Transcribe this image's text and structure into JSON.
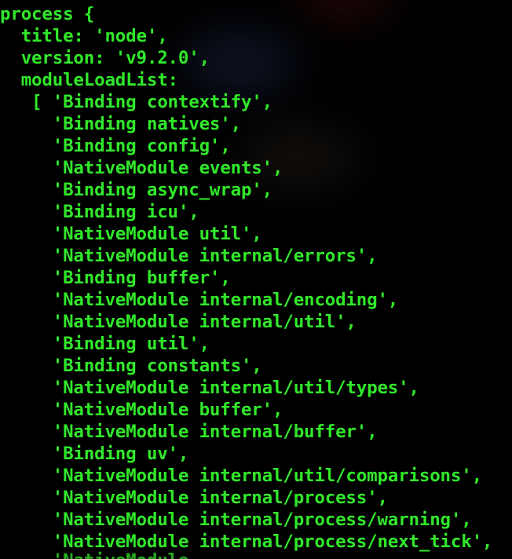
{
  "theme": {
    "text_color": "#31e82a",
    "background": "#000000"
  },
  "terminal": {
    "top_partial": "                   ",
    "lines": [
      "process {",
      "  title: 'node',",
      "  version: 'v9.2.0',",
      "  moduleLoadList:",
      "   [ 'Binding contextify',",
      "     'Binding natives',",
      "     'Binding config',",
      "     'NativeModule events',",
      "     'Binding async_wrap',",
      "     'Binding icu',",
      "     'NativeModule util',",
      "     'NativeModule internal/errors',",
      "     'Binding buffer',",
      "     'NativeModule internal/encoding',",
      "     'NativeModule internal/util',",
      "     'Binding util',",
      "     'Binding constants',",
      "     'NativeModule internal/util/types',",
      "     'NativeModule buffer',",
      "     'NativeModule internal/buffer',",
      "     'Binding uv',",
      "     'NativeModule internal/util/comparisons',",
      "     'NativeModule internal/process',",
      "     'NativeModule internal/process/warning',",
      "     'NativeModule internal/process/next_tick',"
    ],
    "bottom_partial": "     'NativeModule"
  }
}
